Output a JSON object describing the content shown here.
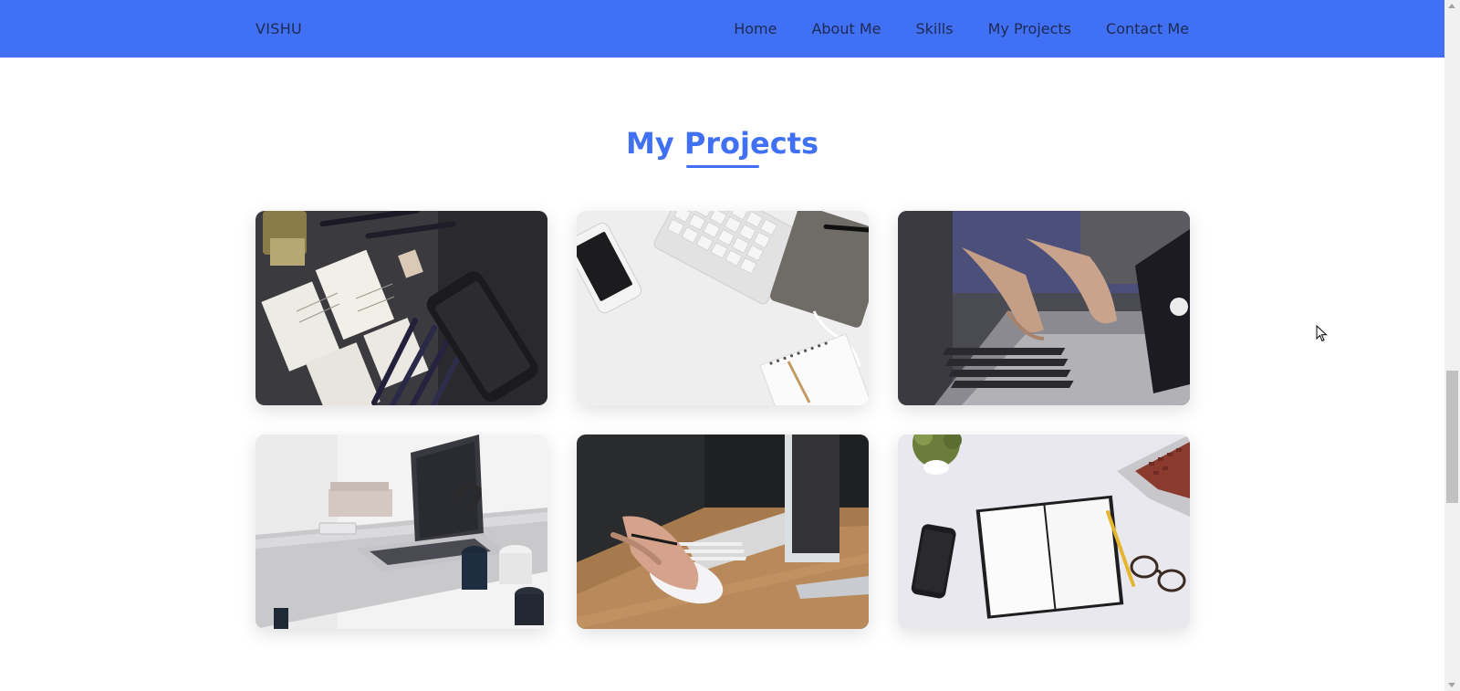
{
  "navbar": {
    "brand": "VISHU",
    "links": [
      "Home",
      "About Me",
      "Skills",
      "My Projects",
      "Contact Me"
    ],
    "bg_color": "#4070f4"
  },
  "projects": {
    "title": "My Projects",
    "accent_color": "#4070f4",
    "items": [
      {
        "image": "sketches-pencils-phone-photo"
      },
      {
        "image": "keyboard-phone-notebook-flatlay-photo"
      },
      {
        "image": "hands-typing-laptop-photo"
      },
      {
        "image": "laptop-on-desk-photo"
      },
      {
        "image": "hand-on-mouse-photo"
      },
      {
        "image": "open-notebook-phone-glasses-photo"
      }
    ]
  }
}
